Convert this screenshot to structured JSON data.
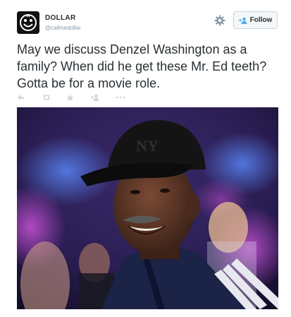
{
  "user": {
    "display_name": "DOLLAR",
    "handle": "@callmedollar",
    "avatar_icon": "smiley-face-logo"
  },
  "header": {
    "settings_icon": "gear-icon",
    "follow_label": "Follow",
    "follow_icon": "add-person-icon"
  },
  "tweet": {
    "text": "May we discuss Denzel Washington as a family? When did he get these Mr. Ed teeth? Gotta be for a movie role."
  },
  "actions": [
    {
      "icon": "reply-icon"
    },
    {
      "icon": "retweet-icon"
    },
    {
      "icon": "favorite-star-icon"
    },
    {
      "icon": "follow-person-icon"
    },
    {
      "icon": "more-dots-icon"
    }
  ],
  "media": {
    "description_icon": "photo",
    "cap_logo_text": "NY"
  },
  "colors": {
    "text": "#292f33",
    "muted": "#8899a6",
    "action_icons": "#ccd6dd",
    "button_bg": "#f5f8fa",
    "button_border": "#c9d4dd",
    "follow_icon": "#55acee"
  }
}
